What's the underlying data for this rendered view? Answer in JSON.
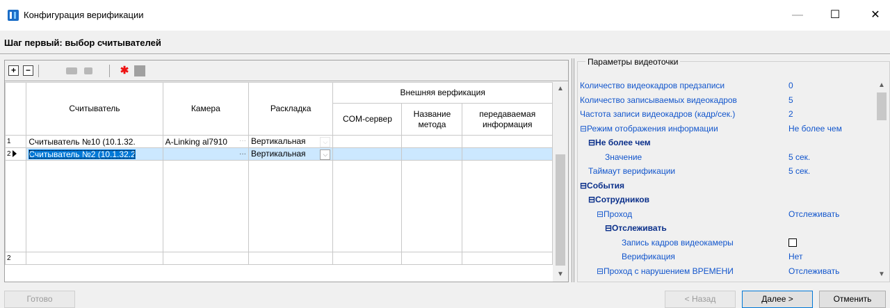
{
  "window": {
    "title": "Конфигурация верификации",
    "controls": [
      "—",
      "☐",
      "✕"
    ]
  },
  "step_title": "Шаг первый: выбор считывателей",
  "toolbar": {
    "add": "+",
    "remove": "−"
  },
  "grid": {
    "headers": {
      "reader": "Считыватель",
      "camera": "Камера",
      "layout": "Раскладка",
      "external": "Внешняя верфикация",
      "com_server": "COM-сервер",
      "method": "Название метода",
      "info": "передаваемая информация"
    },
    "rows": [
      {
        "num": "1",
        "reader": "Считыватель №10 (10.1.32.",
        "camera": "A-Linking al7910",
        "layout": "Вертикальная",
        "com": "",
        "method": "",
        "info": ""
      },
      {
        "num": "2",
        "reader": "Считыватель №2 (10.1.32.2",
        "camera": "",
        "layout": "Вертикальная",
        "com": "",
        "method": "",
        "info": ""
      }
    ],
    "footer_num": "2"
  },
  "params": {
    "title": "Параметры видеоточки",
    "rows": [
      {
        "name": "Количество видеокадров предзаписи",
        "value": "0",
        "indent": 0,
        "bold": false
      },
      {
        "name": "Количество записываемых видеокадров",
        "value": "5",
        "indent": 0,
        "bold": false
      },
      {
        "name": "Частота записи видеокадров (кадр/сек.)",
        "value": "2",
        "indent": 0,
        "bold": false
      },
      {
        "name": "⊟Режим отображения информации",
        "value": "Не более чем",
        "indent": 0,
        "bold": false
      },
      {
        "name": "⊟Не более чем",
        "value": "",
        "indent": 1,
        "bold": true
      },
      {
        "name": "Значение",
        "value": "5 сек.",
        "indent": 3,
        "bold": false
      },
      {
        "name": "Таймаут верификации",
        "value": "5 сек.",
        "indent": 1,
        "bold": false
      },
      {
        "name": "⊟События",
        "value": "",
        "indent": 0,
        "bold": true
      },
      {
        "name": "⊟Сотрудников",
        "value": "",
        "indent": 1,
        "bold": true
      },
      {
        "name": "⊟Проход",
        "value": "Отслеживать",
        "indent": 2,
        "bold": false
      },
      {
        "name": "⊟Отслеживать",
        "value": "",
        "indent": 3,
        "bold": true
      },
      {
        "name": "Запись кадров видеокамеры",
        "value": "",
        "indent": 5,
        "bold": false,
        "checkbox": true
      },
      {
        "name": "Верификация",
        "value": "Нет",
        "indent": 5,
        "bold": false
      },
      {
        "name": "⊟Проход с нарушением ВРЕМЕНИ",
        "value": "Отслеживать",
        "indent": 2,
        "bold": false
      }
    ]
  },
  "buttons": {
    "done": "Готово",
    "back": "< Назад",
    "next": "Далее >",
    "cancel": "Отменить"
  }
}
